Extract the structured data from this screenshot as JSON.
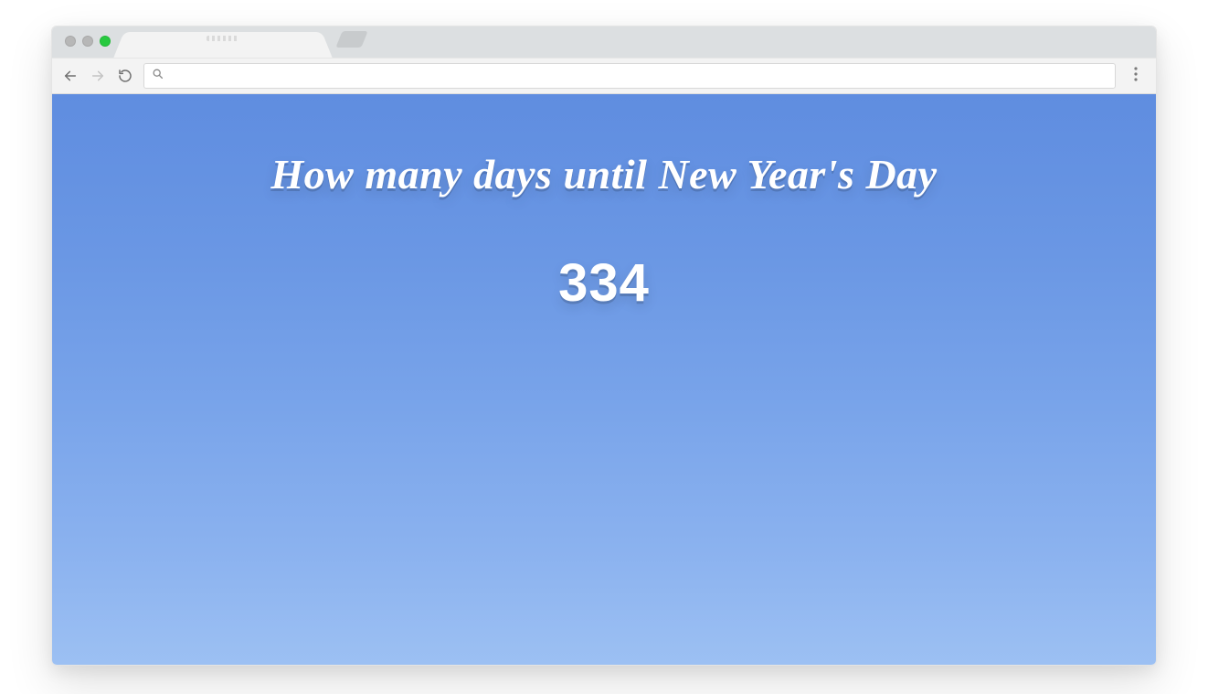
{
  "browser": {
    "url_value": "",
    "url_placeholder": ""
  },
  "page": {
    "headline": "How many days until New Year's Day",
    "days_remaining": "334"
  },
  "colors": {
    "viewport_top": "#5f8de0",
    "viewport_bottom": "#9cc0f3",
    "text": "#ffffff"
  }
}
